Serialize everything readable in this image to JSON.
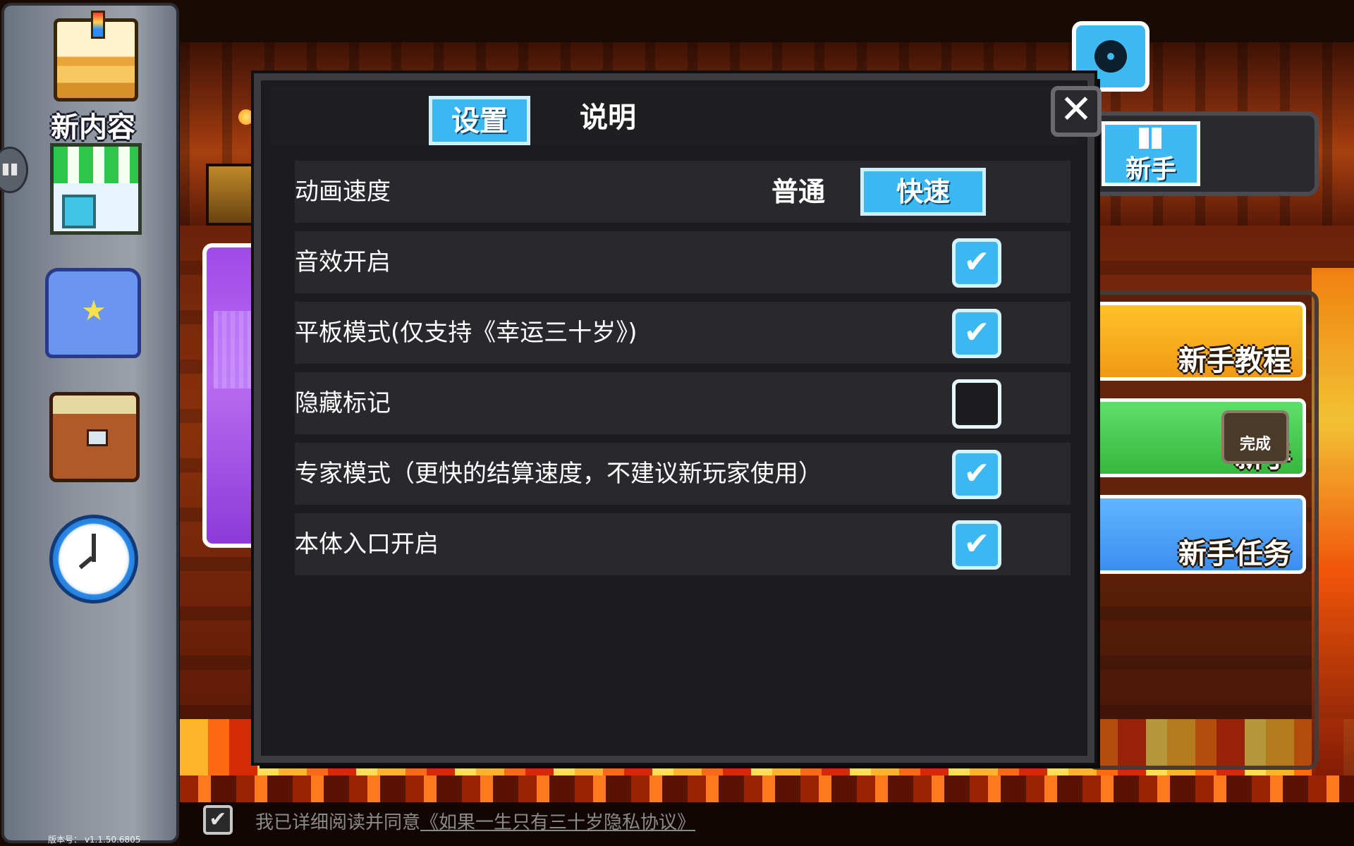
{
  "sidebar": {
    "new_content_label": "新内容",
    "version_text": "版本号： v1.1.50.6805"
  },
  "right_panel": {
    "novice_tab_label": "新手",
    "buttons": [
      {
        "label": "新手教程"
      },
      {
        "label": "新手"
      },
      {
        "label": "新手任务"
      }
    ],
    "done_badge": "完成"
  },
  "modal": {
    "tabs": [
      {
        "label": "设置",
        "active": true
      },
      {
        "label": "说明",
        "active": false
      }
    ],
    "close_symbol": "✕",
    "settings": [
      {
        "label": "动画速度",
        "option_normal": "普通",
        "option_fast": "快速",
        "selected": "快速"
      },
      {
        "label": "音效开启",
        "checked": true
      },
      {
        "label": "平板模式(仅支持《幸运三十岁》)",
        "checked": true
      },
      {
        "label": "隐藏标记",
        "checked": false
      },
      {
        "label": "专家模式（更快的结算速度，不建议新玩家使用）",
        "checked": true
      },
      {
        "label": "本体入口开启",
        "checked": true
      }
    ],
    "check_glyph": "✔"
  },
  "agreement": {
    "checked": true,
    "prefix": "我已详细阅读并同意",
    "link": "《如果一生只有三十岁隐私协议》"
  },
  "colors": {
    "accent_blue": "#3bb8f2",
    "modal_bg": "#1c1c1f",
    "row_bg": "#29292d"
  }
}
